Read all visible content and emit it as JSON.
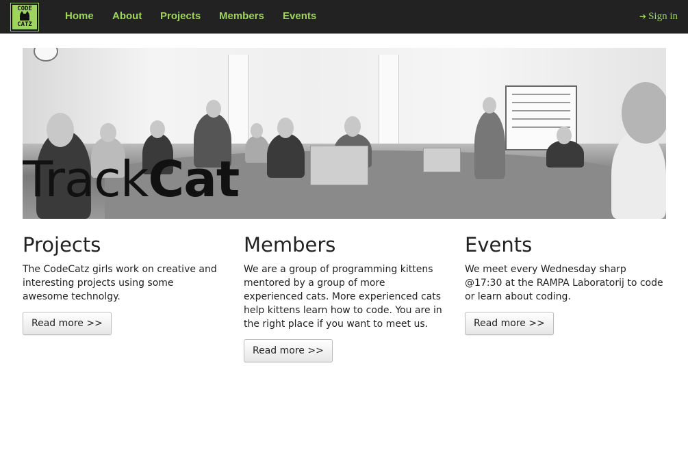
{
  "nav": {
    "logo_top": "CODE",
    "logo_bottom": "CATZ",
    "links": [
      "Home",
      "About",
      "Projects",
      "Members",
      "Events"
    ],
    "signin_label": "Sign in",
    "accent_color": "#9fd45f",
    "background_color": "#222222",
    "signin_icon": "sign-in-icon"
  },
  "hero": {
    "title_part1": "Track",
    "title_part2": "Cat"
  },
  "columns": [
    {
      "title": "Projects",
      "text": "The CodeCatz girls work on creative and interesting projects using some awesome technolgy.",
      "button": "Read more >>"
    },
    {
      "title": "Members",
      "text": "We are a group of programming kittens mentored by a group of more experienced cats. More experienced cats help kittens learn how to code. You are in the right place if you want to meet us.",
      "button": "Read more >>"
    },
    {
      "title": "Events",
      "text": "We meet every Wednesday sharp @17:30 at the RAMPA Laboratorij to code or learn about coding.",
      "button": "Read more >>"
    }
  ]
}
